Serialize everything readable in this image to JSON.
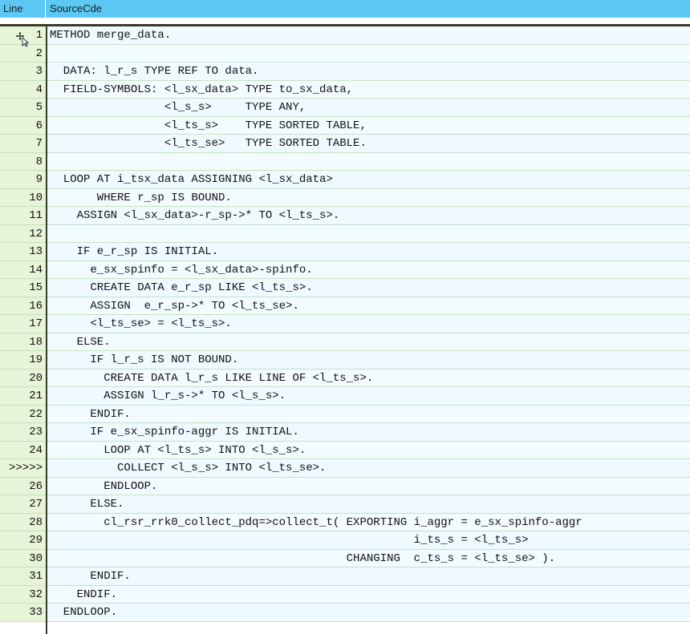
{
  "header": {
    "col_line": "Line",
    "col_source": "SourceCde"
  },
  "lines": [
    {
      "no": "1",
      "code": "METHOD merge_data."
    },
    {
      "no": "2",
      "code": ""
    },
    {
      "no": "3",
      "code": "  DATA: l_r_s TYPE REF TO data."
    },
    {
      "no": "4",
      "code": "  FIELD-SYMBOLS: <l_sx_data> TYPE to_sx_data,"
    },
    {
      "no": "5",
      "code": "                 <l_s_s>     TYPE ANY,"
    },
    {
      "no": "6",
      "code": "                 <l_ts_s>    TYPE SORTED TABLE,"
    },
    {
      "no": "7",
      "code": "                 <l_ts_se>   TYPE SORTED TABLE."
    },
    {
      "no": "8",
      "code": ""
    },
    {
      "no": "9",
      "code": "  LOOP AT i_tsx_data ASSIGNING <l_sx_data>"
    },
    {
      "no": "10",
      "code": "       WHERE r_sp IS BOUND."
    },
    {
      "no": "11",
      "code": "    ASSIGN <l_sx_data>-r_sp->* TO <l_ts_s>."
    },
    {
      "no": "12",
      "code": ""
    },
    {
      "no": "13",
      "code": "    IF e_r_sp IS INITIAL."
    },
    {
      "no": "14",
      "code": "      e_sx_spinfo = <l_sx_data>-spinfo."
    },
    {
      "no": "15",
      "code": "      CREATE DATA e_r_sp LIKE <l_ts_s>."
    },
    {
      "no": "16",
      "code": "      ASSIGN  e_r_sp->* TO <l_ts_se>."
    },
    {
      "no": "17",
      "code": "      <l_ts_se> = <l_ts_s>."
    },
    {
      "no": "18",
      "code": "    ELSE."
    },
    {
      "no": "19",
      "code": "      IF l_r_s IS NOT BOUND."
    },
    {
      "no": "20",
      "code": "        CREATE DATA l_r_s LIKE LINE OF <l_ts_s>."
    },
    {
      "no": "21",
      "code": "        ASSIGN l_r_s->* TO <l_s_s>."
    },
    {
      "no": "22",
      "code": "      ENDIF."
    },
    {
      "no": "23",
      "code": "      IF e_sx_spinfo-aggr IS INITIAL."
    },
    {
      "no": "24",
      "code": "        LOOP AT <l_ts_s> INTO <l_s_s>."
    },
    {
      "no": ">>>>>",
      "code": "          COLLECT <l_s_s> INTO <l_ts_se>."
    },
    {
      "no": "26",
      "code": "        ENDLOOP."
    },
    {
      "no": "27",
      "code": "      ELSE."
    },
    {
      "no": "28",
      "code": "        cl_rsr_rrk0_collect_pdq=>collect_t( EXPORTING i_aggr = e_sx_spinfo-aggr"
    },
    {
      "no": "29",
      "code": "                                                      i_ts_s = <l_ts_s>"
    },
    {
      "no": "30",
      "code": "                                            CHANGING  c_ts_s = <l_ts_se> )."
    },
    {
      "no": "31",
      "code": "      ENDIF."
    },
    {
      "no": "32",
      "code": "    ENDIF."
    },
    {
      "no": "33",
      "code": "  ENDLOOP."
    }
  ]
}
